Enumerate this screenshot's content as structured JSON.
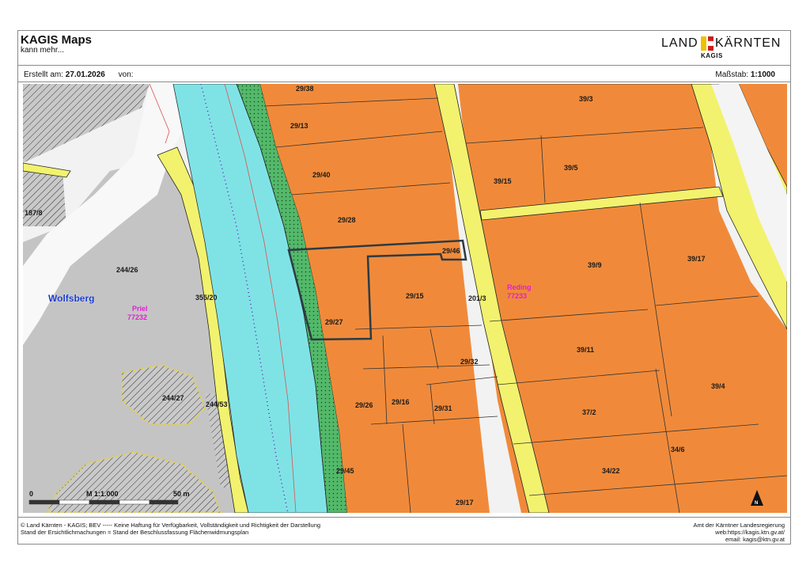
{
  "header": {
    "title": "KAGIS Maps",
    "subtitle": "kann mehr...",
    "logo_left": "LAND",
    "logo_right": "KÄRNTEN",
    "logo_sub": "KAGIS"
  },
  "meta": {
    "created_label": "Erstellt am:",
    "created_date": "27.01.2026",
    "from_label": "von:",
    "scale_label": "Maßstab:",
    "scale_value": "1:1000"
  },
  "map": {
    "parcels": [
      "29/38",
      "39/3",
      "29/13",
      "29/40",
      "39/5",
      "39/15",
      "187/8",
      "29/28",
      "29/46",
      "39/9",
      "39/17",
      "244/26",
      "355/20",
      "201/3",
      "29/15",
      "29/27",
      "39/11",
      "39/4",
      "29/32",
      "244/27",
      "244/53",
      "29/26",
      "29/16",
      "29/31",
      "37/2",
      "34/6",
      "29/45",
      "34/22",
      "29/17"
    ],
    "place_name": "Wolfsberg",
    "zones": [
      {
        "name": "Priel",
        "number": "77232"
      },
      {
        "name": "Reding",
        "number": "77233"
      }
    ],
    "scalebar": {
      "start": "0",
      "middle": "M 1:1.000",
      "end": "50 m"
    },
    "north_letter": "N",
    "colors": {
      "building_land": "#f08a3a",
      "road": "#f2f26e",
      "water": "#7fe3e6",
      "green": "#53b96a",
      "grey": "#c9c9c9"
    }
  },
  "footer": {
    "line1": "© Land Kärnten - KAGIS; BEV ----- Keine Haftung für Verfügbarkeit, Vollständigkeit und Richtigkeit der Darstellung",
    "line2": "Stand der Ersichtlichmachungen = Stand der Beschlussfassung Flächenwidmungsplan",
    "right1": "Amt der Kärntner Landesregierung",
    "right2": "web:https://kagis.ktn.gv.at/",
    "right3": "email: kagis@ktn.gv.at"
  }
}
